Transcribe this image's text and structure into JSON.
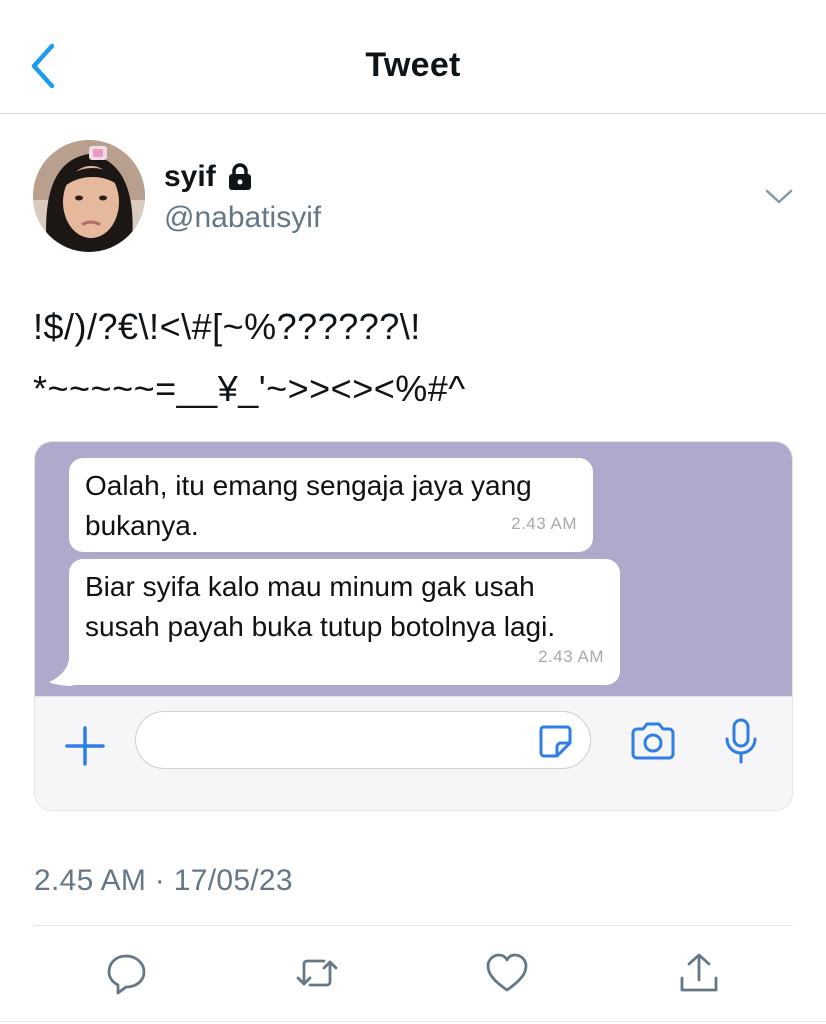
{
  "header": {
    "title": "Tweet",
    "back_icon": "chevron-left-icon"
  },
  "author": {
    "display_name": "syif",
    "handle": "@nabatisyif",
    "protected_icon": "lock-icon",
    "menu_icon": "chevron-down-icon"
  },
  "tweet": {
    "text_lines": [
      "!$/)/?€\\!<\\#[~%??????\\!",
      "*~~~~~=__¥_'~>><><%#^"
    ],
    "timestamp": "2.45 AM · 17/05/23"
  },
  "media": {
    "chat": {
      "messages": [
        {
          "lines": [
            "Oalah, itu emang sengaja jaya yang",
            "bukanya."
          ],
          "time": "2.43 AM"
        },
        {
          "lines": [
            "Biar syifa kalo mau minum gak usah",
            "susah payah buka tutup botolnya lagi."
          ],
          "time": "2.43 AM"
        }
      ],
      "input_placeholder": "",
      "colors": {
        "background": "#aeaacb",
        "bubble": "#ffffff",
        "accent": "#2f7ee6"
      }
    }
  },
  "actions": [
    {
      "name": "reply",
      "icon": "reply-icon"
    },
    {
      "name": "retweet",
      "icon": "retweet-icon"
    },
    {
      "name": "like",
      "icon": "heart-icon"
    },
    {
      "name": "share",
      "icon": "share-icon"
    }
  ],
  "colors": {
    "accent": "#1d9bf0",
    "secondary_text": "#657786",
    "icon_gray": "#657786"
  }
}
